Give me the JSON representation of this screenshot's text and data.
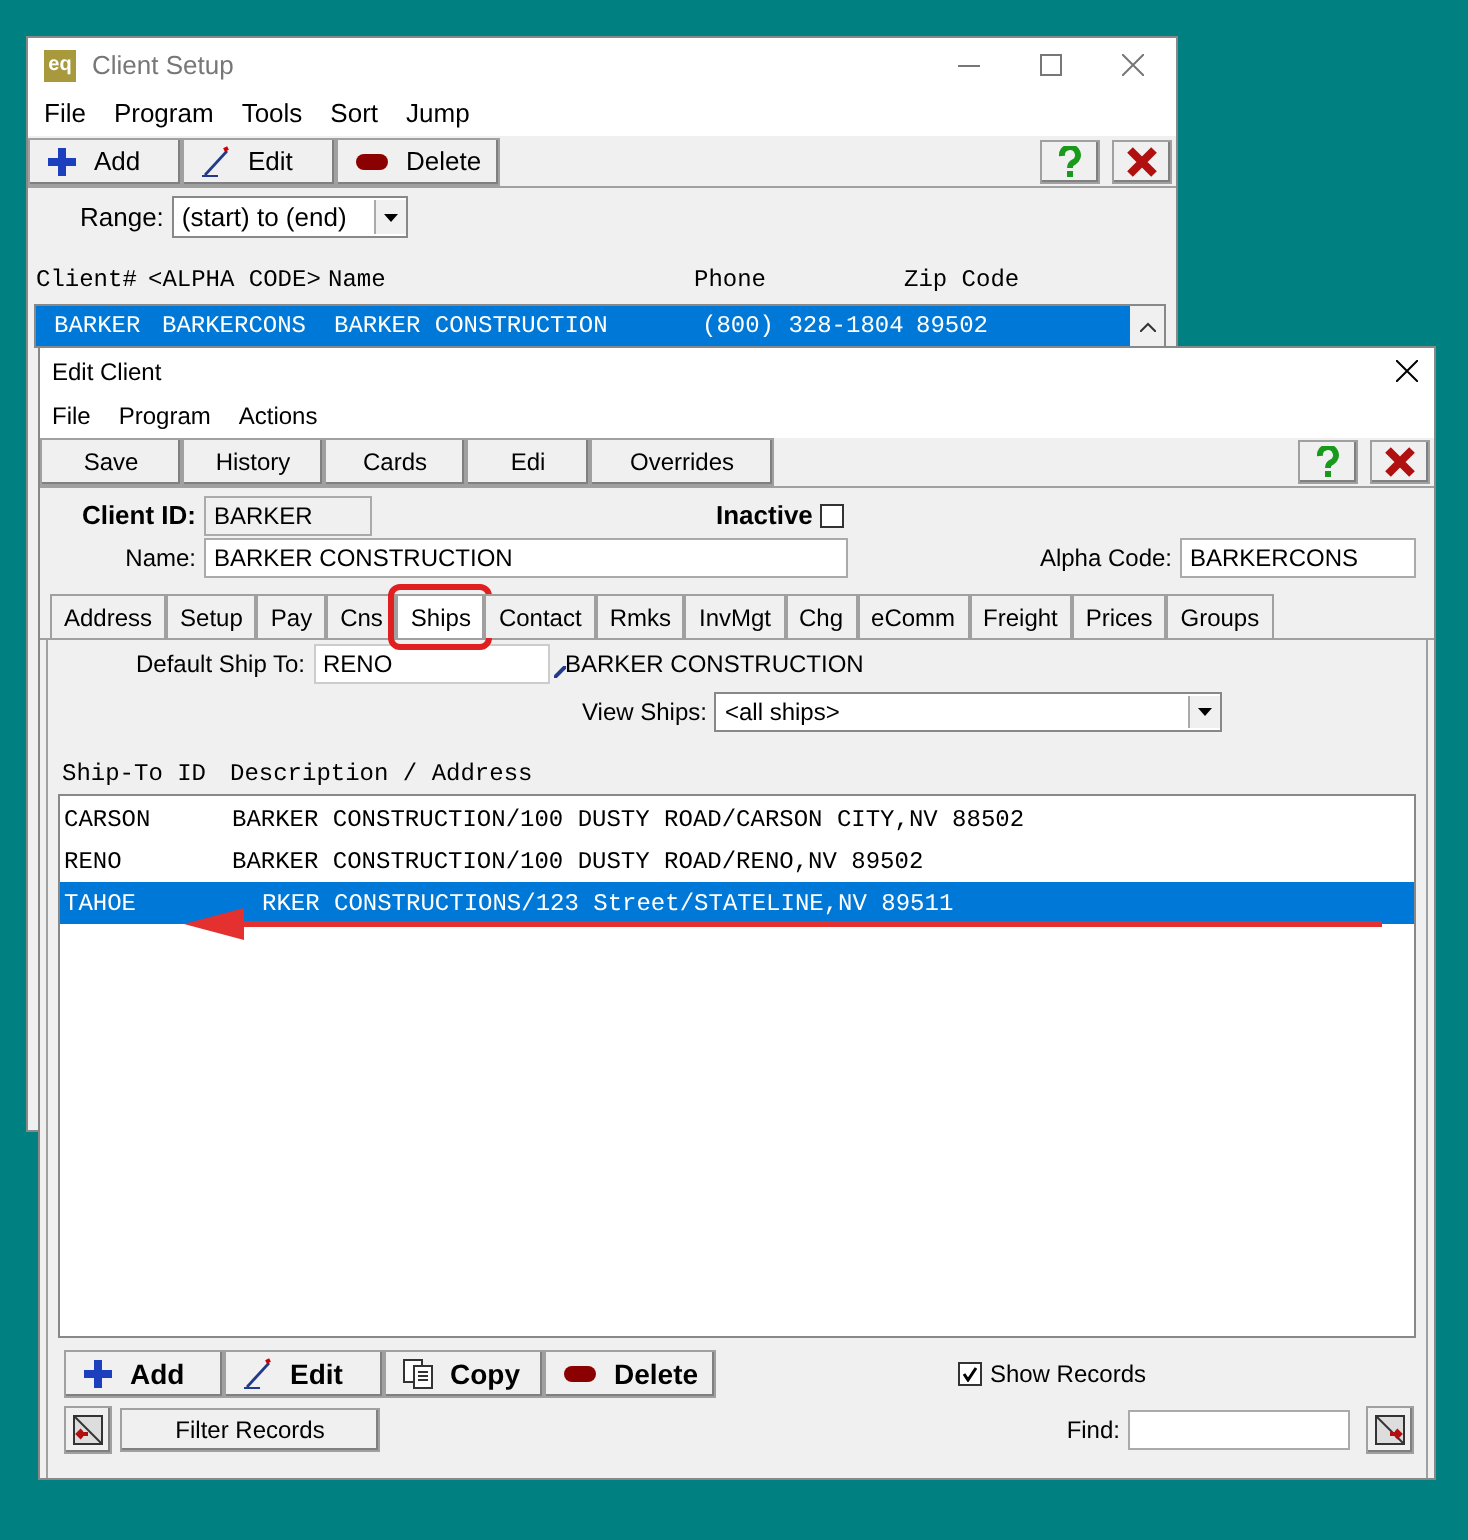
{
  "background_window": {
    "logo": "eq",
    "title": "Client Setup",
    "menu": [
      "File",
      "Program",
      "Tools",
      "Sort",
      "Jump"
    ],
    "toolbar": [
      {
        "label": "Add",
        "kind": "add"
      },
      {
        "label": "Edit",
        "kind": "edit"
      },
      {
        "label": "Delete",
        "kind": "delete"
      }
    ],
    "range": {
      "label": "Range:",
      "value": "(start) to (end)"
    },
    "columns": [
      "Client#",
      "<ALPHA CODE>",
      "Name",
      "Phone",
      "Zip Code"
    ],
    "rows": [
      {
        "cells": [
          "BARKER",
          "BARKERCONS",
          "BARKER CONSTRUCTION",
          "(800) 328-1804",
          "89502"
        ],
        "selected": true
      }
    ]
  },
  "edit_window": {
    "title": "Edit Client",
    "menu": [
      "File",
      "Program",
      "Actions"
    ],
    "toolbar": [
      "Save",
      "History",
      "Cards",
      "Edi",
      "Overrides"
    ],
    "client_id": {
      "label": "Client ID:",
      "value": "BARKER"
    },
    "inactive": {
      "label": "Inactive",
      "checked": false
    },
    "name": {
      "label": "Name:",
      "value": "BARKER CONSTRUCTION"
    },
    "alpha_code": {
      "label": "Alpha Code:",
      "value": "BARKERCONS"
    },
    "tabs": [
      {
        "label": "Address",
        "selected": false
      },
      {
        "label": "Setup",
        "selected": false
      },
      {
        "label": "Pay",
        "selected": false
      },
      {
        "label": "Cns",
        "selected": false
      },
      {
        "label": "Ships",
        "selected": true
      },
      {
        "label": "Contact",
        "selected": false
      },
      {
        "label": "Rmks",
        "selected": false
      },
      {
        "label": "InvMgt",
        "selected": false
      },
      {
        "label": "Chg",
        "selected": false
      },
      {
        "label": "eComm",
        "selected": false
      },
      {
        "label": "Freight",
        "selected": false
      },
      {
        "label": "Prices",
        "selected": false
      },
      {
        "label": "Groups",
        "selected": false
      }
    ],
    "default_ship_to": {
      "label": "Default Ship To:",
      "value": "RENO",
      "description": "BARKER CONSTRUCTION"
    },
    "view_ships": {
      "label": "View Ships:",
      "value": "<all ships>"
    },
    "columns": [
      "Ship-To ID",
      "Description / Address"
    ],
    "rows": [
      {
        "id": "CARSON",
        "description": "BARKER CONSTRUCTION/100 DUSTY ROAD/CARSON CITY,NV 88502",
        "selected": false
      },
      {
        "id": "RENO",
        "description": "BARKER CONSTRUCTION/100 DUSTY ROAD/RENO,NV 89502",
        "selected": false
      },
      {
        "id": "TAHOE",
        "description": "RKER CONSTRUCTIONS/123 Street/STATELINE,NV 89511",
        "selected": true
      }
    ],
    "bottom_buttons": [
      {
        "label": "Add",
        "kind": "add"
      },
      {
        "label": "Edit",
        "kind": "edit"
      },
      {
        "label": "Copy",
        "kind": "copy"
      },
      {
        "label": "Delete",
        "kind": "delete"
      }
    ],
    "show_records": {
      "label": "Show Records",
      "checked": true
    },
    "filter_button": "Filter Records",
    "find": {
      "label": "Find:"
    }
  }
}
